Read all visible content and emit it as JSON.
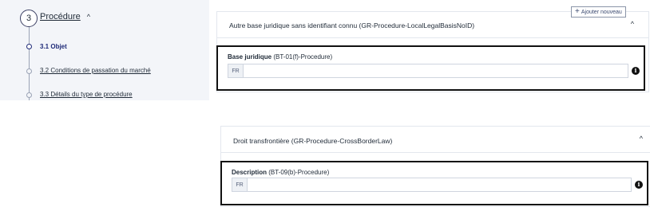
{
  "nav": {
    "step_number": "3",
    "step_title": "Procédure",
    "items": [
      {
        "label": "3.1 Objet"
      },
      {
        "label": "3.2 Conditions de passation du marché"
      },
      {
        "label": "3.3 Détails du type de procédure"
      }
    ]
  },
  "add_button": {
    "label": "Ajouter nouveau"
  },
  "section1": {
    "title": "Autre base juridique sans identifiant connu (GR-Procedure-LocalLegalBasisNoID)",
    "field": {
      "label_bold": "Base juridique",
      "label_suffix": " (BT-01(f)-Procedure)",
      "lang": "FR",
      "value": ""
    }
  },
  "section2": {
    "title": "Droit transfrontière (GR-Procedure-CrossBorderLaw)",
    "field": {
      "label_bold": "Description",
      "label_suffix": " (BT-09(b)-Procedure)",
      "lang": "FR",
      "value": ""
    }
  },
  "icons": {
    "chevron_up": "^",
    "info": "i",
    "plus": "+"
  }
}
